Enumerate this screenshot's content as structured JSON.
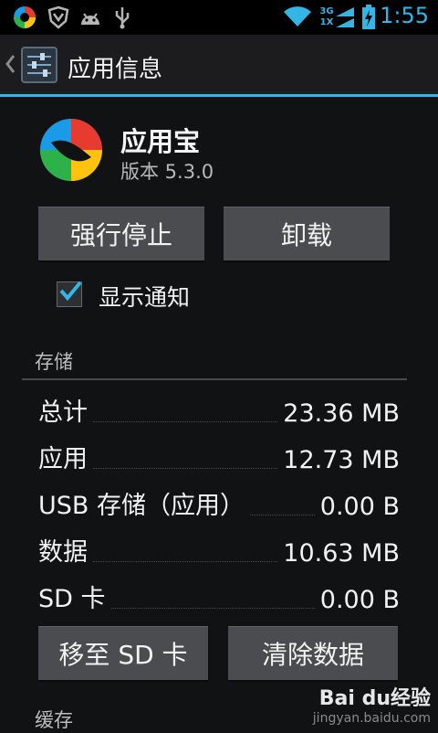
{
  "status_bar": {
    "time": "1:55",
    "network_type": "3G",
    "network_sub": "1X",
    "icons": [
      "app-store-notification-icon",
      "shield-icon",
      "android-icon",
      "usb-icon",
      "wifi-icon",
      "signal-icon",
      "battery-charging-icon"
    ]
  },
  "action_bar": {
    "title": "应用信息",
    "icons": [
      "back-chevron-icon",
      "settings-sliders-icon"
    ]
  },
  "app": {
    "name": "应用宝",
    "version": "版本 5.3.0"
  },
  "buttons": {
    "force_stop": "强行停止",
    "uninstall": "卸载",
    "move_to_sd": "移至 SD 卡",
    "clear_data": "清除数据"
  },
  "notifications": {
    "label": "显示通知",
    "checked": true
  },
  "storage": {
    "section_title": "存储",
    "rows": [
      {
        "label": "总计",
        "value": "23.36 MB"
      },
      {
        "label": "应用",
        "value": "12.73 MB"
      },
      {
        "label": "USB 存储（应用）",
        "value": "0.00 B"
      },
      {
        "label": "数据",
        "value": "10.63 MB"
      },
      {
        "label": "SD 卡",
        "value": "0.00 B"
      }
    ]
  },
  "cache": {
    "section_title": "缓存"
  },
  "watermark": {
    "brand": "Bai du经验",
    "url": "jingyan.baidu.com"
  },
  "colors": {
    "accent": "#33b5e5",
    "background": "#111214",
    "button": "#4a4c50"
  }
}
